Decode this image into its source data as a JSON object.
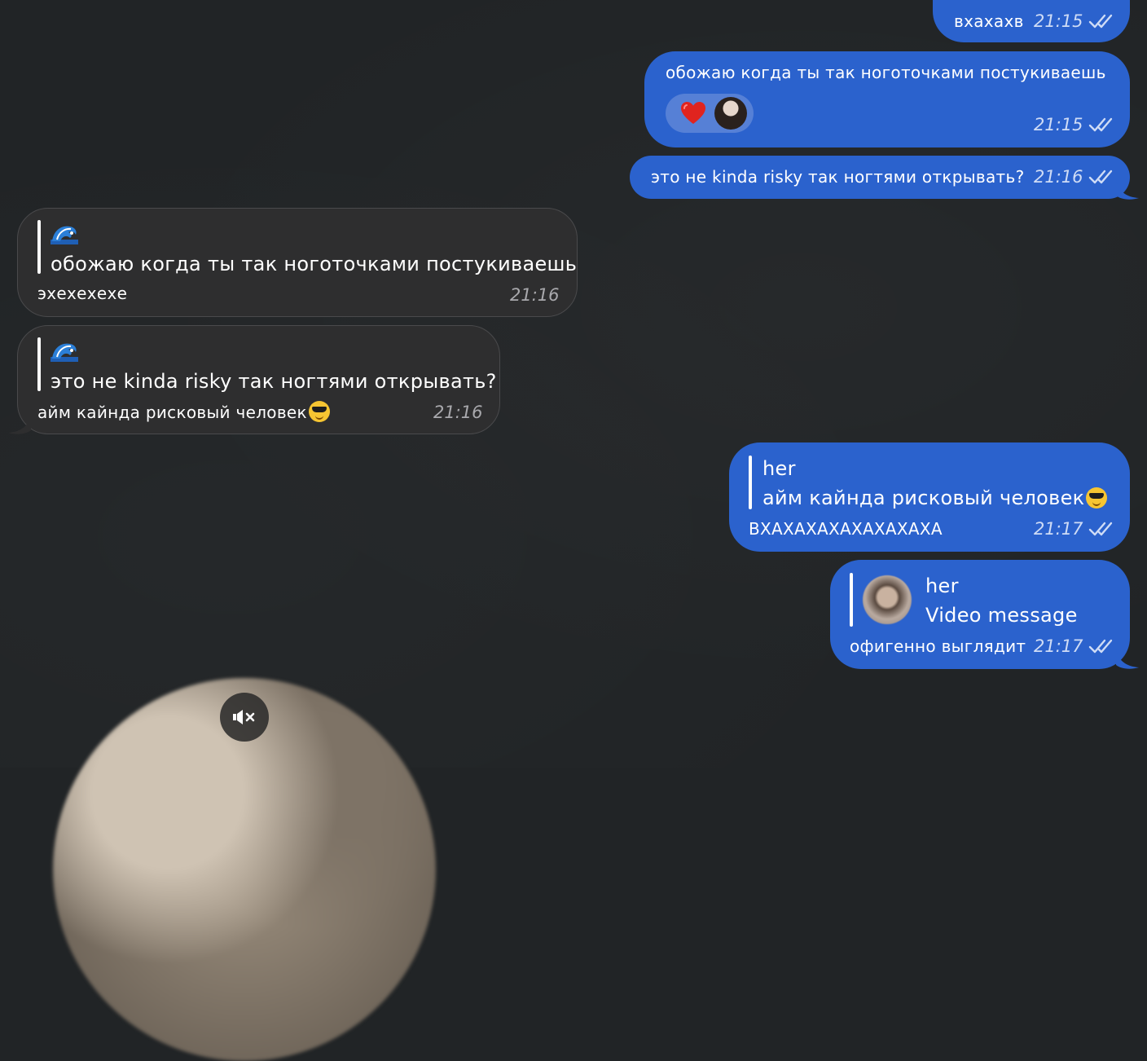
{
  "messages": {
    "m1": {
      "text": "вхахахв",
      "time": "21:15"
    },
    "m2": {
      "text": "обожаю когда ты так ноготочками постукиваешь",
      "time": "21:15",
      "reaction": "heart"
    },
    "m3": {
      "text": "это не kinda risky так ногтями открывать?",
      "time": "21:16"
    },
    "m4": {
      "reply_quote": "обожаю когда ты так ноготочками постукиваешь",
      "text": "эхехехехе",
      "time": "21:16"
    },
    "m5": {
      "reply_quote": "это не kinda risky так ногтями открывать?",
      "text": "айм кайнда рисковый человек",
      "time": "21:16"
    },
    "m6": {
      "reply_author": "her",
      "reply_quote": "айм кайнда рисковый человек",
      "text": "ВХАХАХАХАХАХАХАХА",
      "time": "21:17"
    },
    "m7": {
      "reply_author": "her",
      "reply_quote": "Video message",
      "text": "офигенно выглядит",
      "time": "21:17"
    }
  },
  "icons": {
    "read": "double-check-icon",
    "mute": "speaker-muted-icon",
    "reply_emoji": "wave-emoji-icon",
    "inline_emoji": "smiling-face-with-sunglasses-emoji"
  },
  "colors": {
    "background": "#212426",
    "outgoing_bubble": "#2b62cd",
    "incoming_bubble": "#2e2e2f"
  }
}
